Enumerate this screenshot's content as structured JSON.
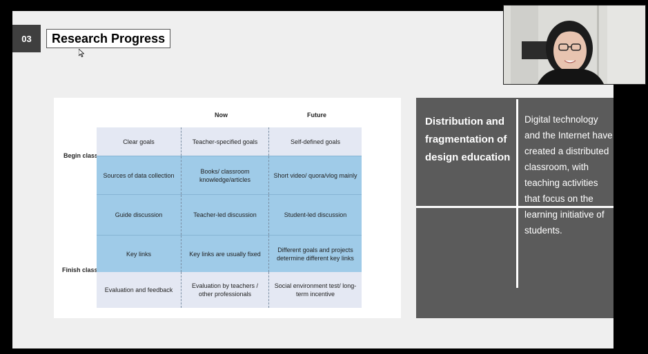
{
  "slide": {
    "section_number": "03",
    "section_title": "Research Progress"
  },
  "table": {
    "columns": [
      "Now",
      "Future"
    ],
    "begin_label": "Begin class",
    "finish_label": "Finish class",
    "rows": [
      [
        "Clear goals",
        "Teacher-specified goals",
        "Self-defined goals"
      ],
      [
        "Sources of data collection",
        "Books/ classroom knowledge/articles",
        "Short video/ quora/vlog mainly"
      ],
      [
        "Guide discussion",
        "Teacher-led discussion",
        "Student-led discussion"
      ],
      [
        "Key links",
        "Key links are usually fixed",
        "Different goals and projects determine different key links"
      ],
      [
        "Evaluation and feedback",
        "Evaluation by teachers / other professionals",
        "Social environment test/ long-term incentive"
      ]
    ]
  },
  "panel": {
    "title": "Distribution and fragmentation of design education",
    "text": "Digital technology and the Internet have created a distributed classroom, with teaching activities that focus on the learning initiative of students."
  },
  "colors": {
    "light_cell": "#e4e8f3",
    "blue_cell": "#9fcbe8",
    "dark_panel": "#5b5b5b"
  }
}
